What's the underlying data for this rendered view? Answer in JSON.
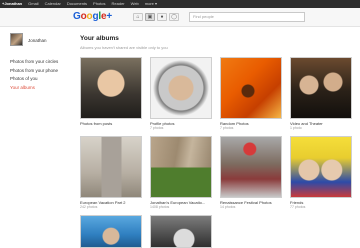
{
  "topbar": {
    "items": [
      "+Jonathan",
      "Gmail",
      "Calendar",
      "Documents",
      "Photos",
      "Reader",
      "Web",
      "more ▾"
    ]
  },
  "header": {
    "logo_text": "Google+",
    "search_placeholder": "Find people",
    "nav_icons": [
      "home-icon",
      "photos-icon",
      "profile-icon",
      "circles-icon"
    ]
  },
  "sidebar": {
    "user_name": "Jonathan",
    "links": [
      "Photos from your circles",
      "Photos from your phone",
      "Photos of you",
      "Your albums"
    ],
    "current_link": "Your albums"
  },
  "main": {
    "title": "Your albums",
    "subtitle": "Albums you haven't shared are visible only to you"
  },
  "albums": [
    {
      "title": "Photos from posts",
      "count": ""
    },
    {
      "title": "Profile photos",
      "count": "7 photos"
    },
    {
      "title": "Random Photos",
      "count": "7 photos"
    },
    {
      "title": "Video and Theater",
      "count": "1 photo"
    },
    {
      "title": "European Vacation Part 2",
      "count": "242 photos"
    },
    {
      "title": "Jonathan's European Vacatio...",
      "count": "1408 photos"
    },
    {
      "title": "Renaissance Festival Photos",
      "count": "14 photos"
    },
    {
      "title": "Friends",
      "count": "77 photos"
    },
    {
      "title": "",
      "count": ""
    },
    {
      "title": "",
      "count": ""
    }
  ],
  "colors": {
    "topbar_bg": "#2d2d2d",
    "accent_red": "#dd4b39",
    "link_text": "#333333"
  }
}
